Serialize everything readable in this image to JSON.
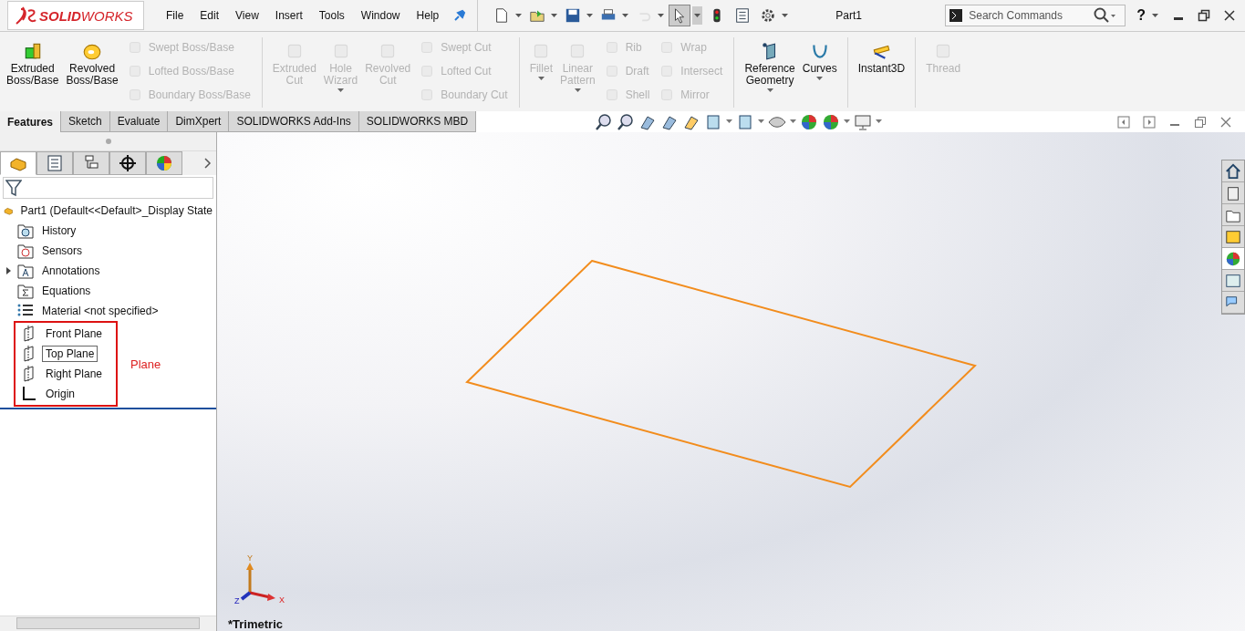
{
  "app": {
    "logo": "**SOLID**WORKS"
  },
  "menus": [
    "File",
    "Edit",
    "View",
    "Insert",
    "Tools",
    "Window",
    "Help"
  ],
  "quick_access": [
    {
      "dropdown": true,
      "pressed": false,
      "disabled": false
    },
    {
      "dropdown": true,
      "pressed": false,
      "disabled": false
    },
    {
      "dropdown": true,
      "pressed": false,
      "disabled": false
    },
    {
      "dropdown": true,
      "pressed": false,
      "disabled": false
    },
    {
      "dropdown": true,
      "pressed": false,
      "disabled": true
    },
    {
      "dropdown": true,
      "pressed": true,
      "disabled": false
    },
    {
      "dropdown": false,
      "pressed": false,
      "disabled": false
    },
    {
      "dropdown": false,
      "pressed": false,
      "disabled": false
    },
    {
      "dropdown": true,
      "pressed": false,
      "disabled": false
    }
  ],
  "document_title": "Part1",
  "search": {
    "placeholder": "Search Commands"
  },
  "help": "?",
  "ribbon": [
    [
      {
        "kind": "large",
        "label": "Extruded\nBoss/Base",
        "disabled": false,
        "dropdown": false
      },
      {
        "kind": "large",
        "label": "Revolved\nBoss/Base",
        "disabled": false,
        "dropdown": false
      },
      {
        "kind": "stack",
        "items": [
          {
            "label": "Swept Boss/Base",
            "disabled": true
          },
          {
            "label": "Lofted Boss/Base",
            "disabled": true
          },
          {
            "label": "Boundary Boss/Base",
            "disabled": true
          }
        ]
      }
    ],
    [
      {
        "kind": "large",
        "label": "Extruded\nCut",
        "disabled": true,
        "dropdown": false
      },
      {
        "kind": "large",
        "label": "Hole\nWizard",
        "disabled": true,
        "dropdown": true
      },
      {
        "kind": "large",
        "label": "Revolved\nCut",
        "disabled": true,
        "dropdown": false
      },
      {
        "kind": "stack",
        "items": [
          {
            "label": "Swept Cut",
            "disabled": true
          },
          {
            "label": "Lofted Cut",
            "disabled": true
          },
          {
            "label": "Boundary Cut",
            "disabled": true
          }
        ]
      }
    ],
    [
      {
        "kind": "large",
        "label": "Fillet",
        "disabled": true,
        "dropdown": true
      },
      {
        "kind": "large",
        "label": "Linear\nPattern",
        "disabled": true,
        "dropdown": true
      },
      {
        "kind": "stack",
        "items": [
          {
            "label": "Rib",
            "disabled": true
          },
          {
            "label": "Draft",
            "disabled": true
          },
          {
            "label": "Shell",
            "disabled": true
          }
        ]
      },
      {
        "kind": "stack",
        "items": [
          {
            "label": "Wrap",
            "disabled": true
          },
          {
            "label": "Intersect",
            "disabled": true
          },
          {
            "label": "Mirror",
            "disabled": true
          }
        ]
      }
    ],
    [
      {
        "kind": "large",
        "label": "Reference\nGeometry",
        "disabled": false,
        "dropdown": true
      },
      {
        "kind": "large",
        "label": "Curves",
        "disabled": false,
        "dropdown": true
      }
    ],
    [
      {
        "kind": "large",
        "label": "Instant3D",
        "disabled": false,
        "dropdown": false
      }
    ],
    [
      {
        "kind": "large",
        "label": "Thread",
        "disabled": true,
        "dropdown": false
      }
    ]
  ],
  "command_tabs": [
    {
      "label": "Features",
      "selected": true
    },
    {
      "label": "Sketch",
      "selected": false
    },
    {
      "label": "Evaluate",
      "selected": false
    },
    {
      "label": "DimXpert",
      "selected": false
    },
    {
      "label": "SOLIDWORKS Add-Ins",
      "selected": false
    },
    {
      "label": "SOLIDWORKS MBD",
      "selected": false
    }
  ],
  "panel_tabs": [
    {
      "selected": true
    },
    {
      "selected": false
    },
    {
      "selected": false
    },
    {
      "selected": false
    },
    {
      "selected": false
    }
  ],
  "feature_tree": {
    "root": "Part1  (Default<<Default>_Display State",
    "items": [
      {
        "label": "History",
        "selected": false
      },
      {
        "label": "Sensors",
        "selected": false
      },
      {
        "label": "Annotations",
        "selected": false,
        "expanded": false
      },
      {
        "label": "Equations",
        "selected": false
      },
      {
        "label": "Material <not specified>",
        "selected": false
      }
    ],
    "highlighted": {
      "note": "Plane",
      "items": [
        {
          "label": "Front Plane",
          "selected": false
        },
        {
          "label": "Top Plane",
          "selected": true
        },
        {
          "label": "Right Plane",
          "selected": false
        },
        {
          "label": "Origin",
          "selected": false
        }
      ]
    }
  },
  "viewport": {
    "view_name": "*Trimetric",
    "triad": {
      "y": "Y",
      "z": "Z",
      "x": "X"
    }
  }
}
